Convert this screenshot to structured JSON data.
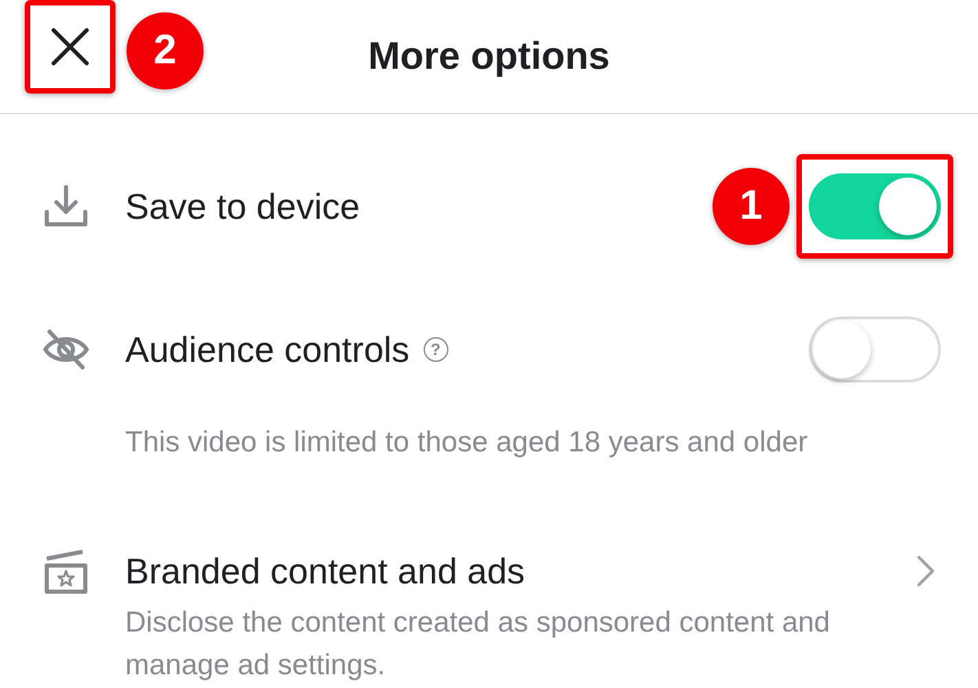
{
  "header": {
    "title": "More options",
    "close_button": {
      "highlighted": true,
      "badge": "2"
    }
  },
  "items": [
    {
      "kind": "toggle",
      "label": "Save to device",
      "on": true,
      "highlighted": true,
      "badge": "1"
    },
    {
      "kind": "toggle",
      "label": "Audience controls",
      "help": "?",
      "description": "This video is limited to those aged 18 years and older",
      "on": false,
      "highlighted": false
    },
    {
      "kind": "link",
      "label": "Branded content and ads",
      "description": "Disclose the content created as sponsored content and manage ad settings."
    }
  ]
}
